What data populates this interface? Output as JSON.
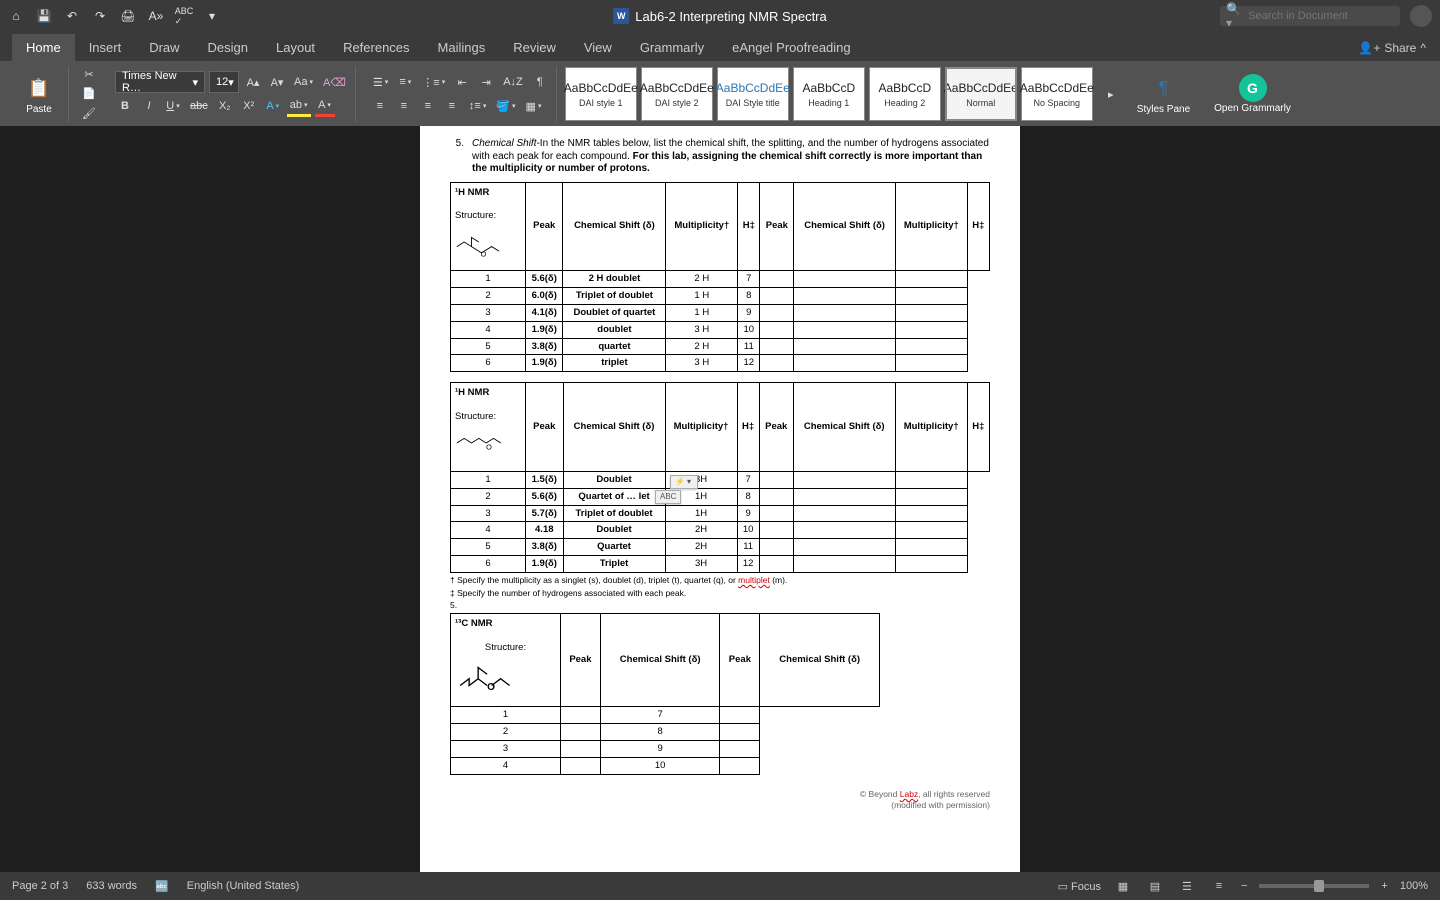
{
  "title": "Lab6-2 Interpreting NMR Spectra",
  "search_placeholder": "Search in Document",
  "tabs": [
    "Home",
    "Insert",
    "Draw",
    "Design",
    "Layout",
    "References",
    "Mailings",
    "Review",
    "View",
    "Grammarly",
    "eAngel Proofreading"
  ],
  "share": "Share",
  "paste": "Paste",
  "font_name": "Times New R…",
  "font_size": "12",
  "styles": [
    {
      "preview": "AaBbCcDdEe",
      "label": "DAI style 1"
    },
    {
      "preview": "AaBbCcDdEe",
      "label": "DAI style 2"
    },
    {
      "preview": "AaBbCcDdEe",
      "label": "DAI Style title",
      "blue": true
    },
    {
      "preview": "AaBbCcD",
      "label": "Heading 1"
    },
    {
      "preview": "AaBbCcD",
      "label": "Heading 2"
    },
    {
      "preview": "AaBbCcDdEe",
      "label": "Normal",
      "sel": true
    },
    {
      "preview": "AaBbCcDdEe",
      "label": "No Spacing"
    }
  ],
  "styles_pane": "Styles Pane",
  "open_grammarly": "Open Grammarly",
  "question_num": "5.",
  "question_lead": "Chemical Shift",
  "question_rest": "-In the NMR tables below, list the chemical shift, the splitting, and the number of hydrogens associated with each peak for each compound. ",
  "question_bold": "For this lab, assigning the chemical shift correctly is more important than the multiplicity or number of protons.",
  "hdr": {
    "hnmr": "¹H NMR",
    "cnmr": "¹³C NMR",
    "structure": "Structure:",
    "peak": "Peak",
    "shift": "Chemical Shift (δ)",
    "mult": "Multiplicity",
    "multd": "Multiplicity†",
    "h": "H‡"
  },
  "table1_rows": [
    {
      "p": "1",
      "s": "5.6(δ)",
      "m": "2 H doublet",
      "h": "2 H",
      "p2": "7"
    },
    {
      "p": "2",
      "s": "6.0(δ)",
      "m": "Triplet of doublet",
      "h": "1 H",
      "p2": "8"
    },
    {
      "p": "3",
      "s": "4.1(δ)",
      "m": "Doublet of quartet",
      "h": "1 H",
      "p2": "9"
    },
    {
      "p": "4",
      "s": "1.9(δ)",
      "m": "doublet",
      "h": "3 H",
      "p2": "10"
    },
    {
      "p": "5",
      "s": "3.8(δ)",
      "m": "quartet",
      "h": "2 H",
      "p2": "11"
    },
    {
      "p": "6",
      "s": "1.9(δ)",
      "m": "triplet",
      "h": "3 H",
      "p2": "12"
    }
  ],
  "table2_rows": [
    {
      "p": "1",
      "s": "1.5(δ)",
      "m": "Doublet",
      "h": "3H",
      "p2": "7"
    },
    {
      "p": "2",
      "s": "5.6(δ)",
      "m": "Quartet of … let",
      "h": "1H",
      "p2": "8"
    },
    {
      "p": "3",
      "s": "5.7(δ)",
      "m": "Triplet of doublet",
      "h": "1H",
      "p2": "9"
    },
    {
      "p": "4",
      "s": "4.18",
      "m": "Doublet",
      "h": "2H",
      "p2": "10"
    },
    {
      "p": "5",
      "s": "3.8(δ)",
      "m": "Quartet",
      "h": "2H",
      "p2": "11"
    },
    {
      "p": "6",
      "s": "1.9(δ)",
      "m": "Triplet",
      "h": "3H",
      "p2": "12"
    }
  ],
  "table3_rows": [
    {
      "p": "1",
      "p2": "7"
    },
    {
      "p": "2",
      "p2": "8"
    },
    {
      "p": "3",
      "p2": "9"
    },
    {
      "p": "4",
      "p2": "10"
    }
  ],
  "footnote1": "† Specify the multiplicity as a singlet (s), doublet (d), triplet (t), quartet (q), or ",
  "footnote1_red": "multiplet",
  "footnote1_end": " (m).",
  "footnote2": "‡ Specify the number of hydrogens associated with each peak.",
  "footnote3": "5.",
  "copyright_pre": "© Beyond ",
  "copyright_red": "Labz",
  "copyright_post": ", all rights reserved",
  "copyright_sub": "(modified with permission)",
  "autocorrect": "ABC",
  "status": {
    "page": "Page 2 of 3",
    "words": "633 words",
    "lang": "English (United States)",
    "focus": "Focus",
    "zoom": "100%"
  }
}
